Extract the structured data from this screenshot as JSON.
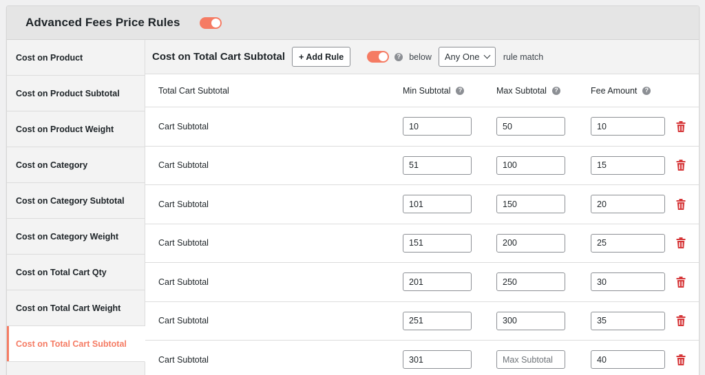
{
  "header": {
    "title": "Advanced Fees Price Rules",
    "enabled": true
  },
  "accent_color": "#f57b63",
  "sidebar": {
    "items": [
      {
        "label": "Cost on Product",
        "active": false
      },
      {
        "label": "Cost on Product Subtotal",
        "active": false
      },
      {
        "label": "Cost on Product Weight",
        "active": false
      },
      {
        "label": "Cost on Category",
        "active": false
      },
      {
        "label": "Cost on Category Subtotal",
        "active": false
      },
      {
        "label": "Cost on Category Weight",
        "active": false
      },
      {
        "label": "Cost on Total Cart Qty",
        "active": false
      },
      {
        "label": "Cost on Total Cart Weight",
        "active": false
      },
      {
        "label": "Cost on Total Cart Subtotal",
        "active": true
      }
    ]
  },
  "toolbar": {
    "section_title": "Cost on Total Cart Subtotal",
    "add_rule_label": "+ Add Rule",
    "enabled": true,
    "help_icon": "?",
    "below_label": "below",
    "match_select": "Any One",
    "match_suffix": "rule match"
  },
  "table": {
    "headers": {
      "name": "Total Cart Subtotal",
      "min": "Min Subtotal",
      "max": "Max Subtotal",
      "fee": "Fee Amount"
    },
    "placeholders": {
      "min": "Min Subtotal",
      "max": "Max Subtotal",
      "fee": "Fee Amount"
    },
    "rows": [
      {
        "name": "Cart Subtotal",
        "min": "10",
        "max": "50",
        "fee": "10"
      },
      {
        "name": "Cart Subtotal",
        "min": "51",
        "max": "100",
        "fee": "15"
      },
      {
        "name": "Cart Subtotal",
        "min": "101",
        "max": "150",
        "fee": "20"
      },
      {
        "name": "Cart Subtotal",
        "min": "151",
        "max": "200",
        "fee": "25"
      },
      {
        "name": "Cart Subtotal",
        "min": "201",
        "max": "250",
        "fee": "30"
      },
      {
        "name": "Cart Subtotal",
        "min": "251",
        "max": "300",
        "fee": "35"
      },
      {
        "name": "Cart Subtotal",
        "min": "301",
        "max": "",
        "fee": "40"
      }
    ]
  },
  "icons": {
    "delete": "trash-icon",
    "help": "help-icon"
  }
}
